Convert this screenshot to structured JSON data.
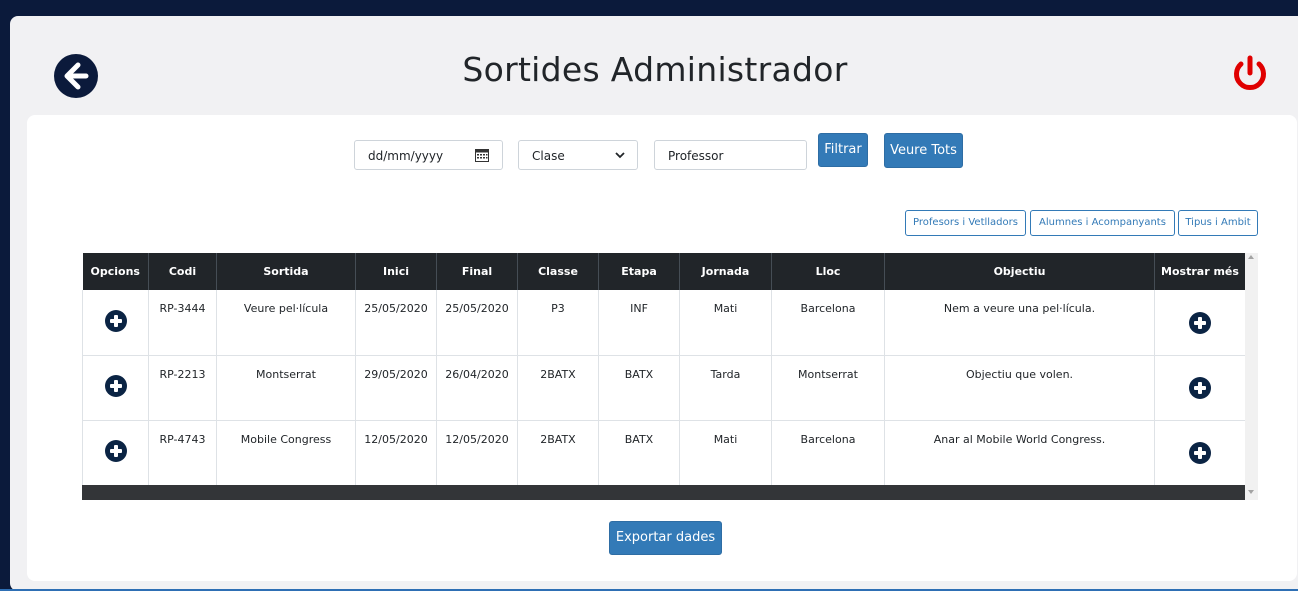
{
  "header": {
    "title": "Sortides Administrador",
    "back_icon": "arrow-left-circle-icon",
    "power_icon": "power-icon",
    "power_color": "#e00000"
  },
  "filters": {
    "date_placeholder": "dd/mm/yyyy",
    "class_select_value": "Clase",
    "professor_placeholder": "Professor",
    "filtrar_label": "Filtrar",
    "veure_tots_label": "Veure Tots"
  },
  "links": {
    "profesors": "Profesors i Vetlladors",
    "alumnes": "Alumnes i Acompanyants",
    "tipus": "Tipus i Ambit"
  },
  "table": {
    "headers": [
      "Opcions",
      "Codi",
      "Sortida",
      "Inici",
      "Final",
      "Classe",
      "Etapa",
      "Jornada",
      "Lloc",
      "Objectiu",
      "Mostrar més"
    ],
    "rows": [
      {
        "codi": "RP-3444",
        "sortida": "Veure pel·lícula",
        "inici": "25/05/2020",
        "final": "25/05/2020",
        "classe": "P3",
        "etapa": "INF",
        "jornada": "Mati",
        "lloc": "Barcelona",
        "objectiu": "Nem a veure una pel·lícula."
      },
      {
        "codi": "RP-2213",
        "sortida": "Montserrat",
        "inici": "29/05/2020",
        "final": "26/04/2020",
        "classe": "2BATX",
        "etapa": "BATX",
        "jornada": "Tarda",
        "lloc": "Montserrat",
        "objectiu": "Objectiu que volen."
      },
      {
        "codi": "RP-4743",
        "sortida": "Mobile Congress",
        "inici": "12/05/2020",
        "final": "12/05/2020",
        "classe": "2BATX",
        "etapa": "BATX",
        "jornada": "Mati",
        "lloc": "Barcelona",
        "objectiu": "Anar al Mobile World Congress."
      }
    ]
  },
  "footer": {
    "export_label": "Exportar dades"
  },
  "colors": {
    "primary": "#337ab7",
    "table_header": "#212529",
    "icon_dark": "#0b1a3b"
  }
}
